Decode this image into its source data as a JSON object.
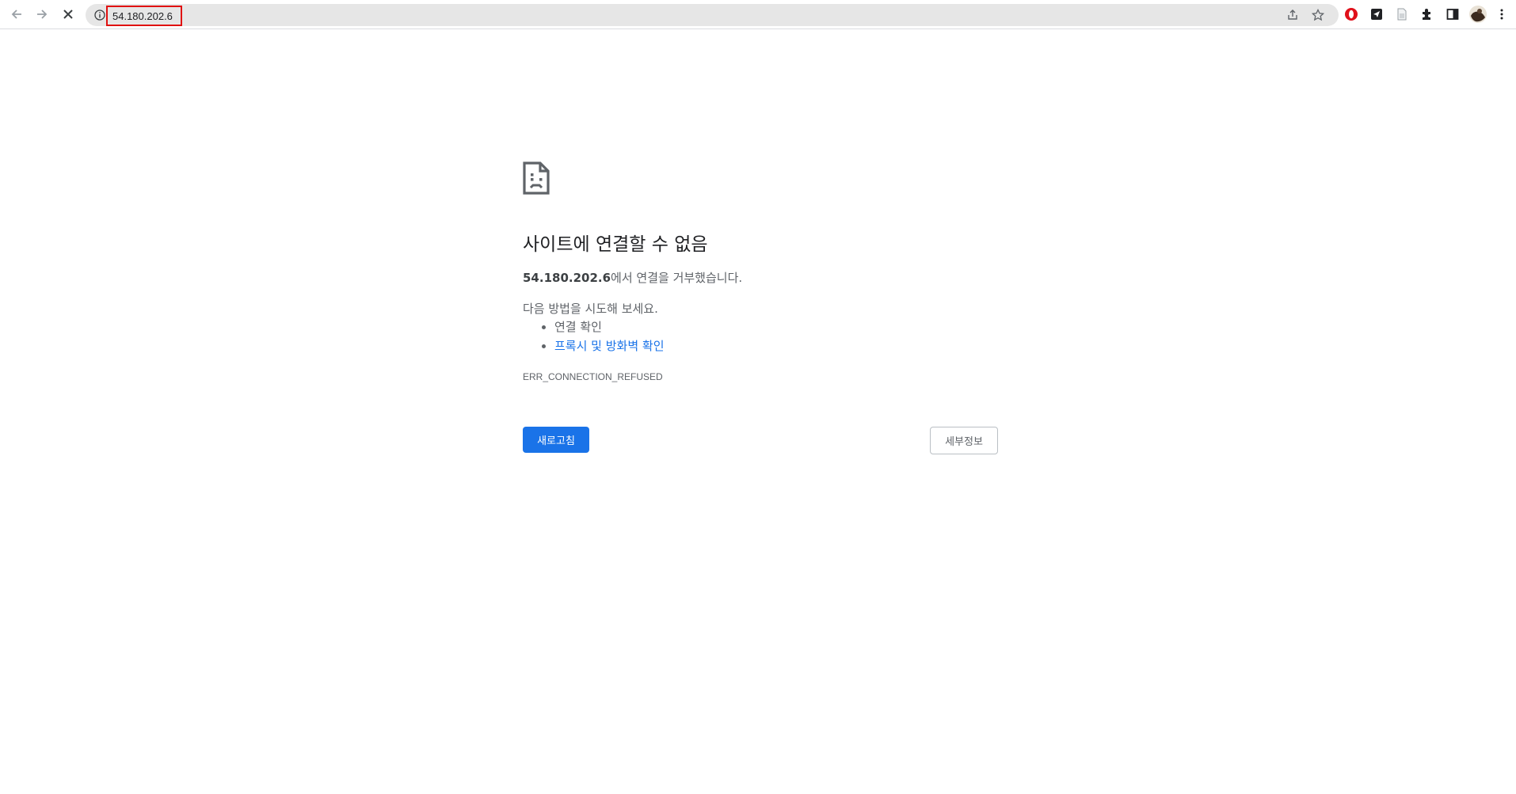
{
  "browser": {
    "address_bar": {
      "url": "54.180.202.6"
    },
    "icons": {
      "back": "back-arrow-icon",
      "forward": "forward-arrow-icon",
      "stop": "close-icon",
      "site_info": "info-icon",
      "share": "share-icon",
      "bookmark": "star-icon",
      "extensions": [
        "opera-icon",
        "send-icon",
        "document-icon",
        "puzzle-icon",
        "side-panel-icon",
        "profile-avatar",
        "menu-icon"
      ]
    },
    "colors": {
      "highlight": "#e01010",
      "accent": "#1a73e8"
    }
  },
  "error_page": {
    "icon": "sad-document-icon",
    "title": "사이트에 연결할 수 없음",
    "message": {
      "host": "54.180.202.6",
      "text": "에서 연결을 거부했습니다."
    },
    "try_label": "다음 방법을 시도해 보세요.",
    "suggestions": [
      {
        "label": "연결 확인",
        "link": false
      },
      {
        "label": "프록시 및 방화벽 확인",
        "link": true
      }
    ],
    "error_code": "ERR_CONNECTION_REFUSED",
    "reload_label": "새로고침",
    "details_label": "세부정보"
  }
}
